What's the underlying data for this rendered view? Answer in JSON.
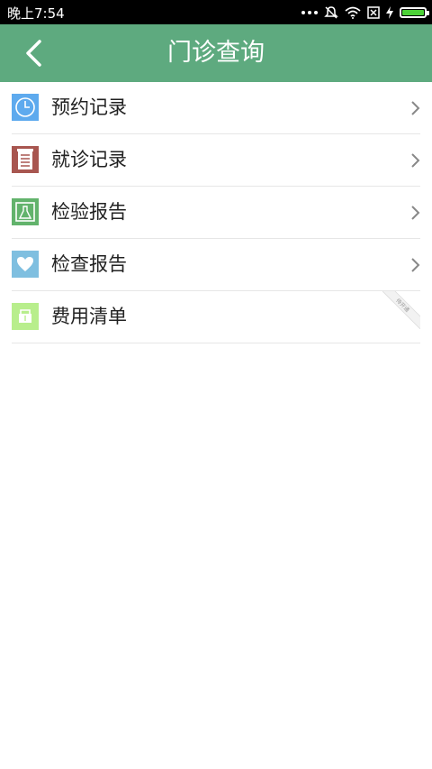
{
  "statusbar": {
    "time": "晚上7:54"
  },
  "appbar": {
    "title": "门诊查询"
  },
  "menu": [
    {
      "label": "预约记录"
    },
    {
      "label": "就诊记录"
    },
    {
      "label": "检验报告"
    },
    {
      "label": "检查报告"
    },
    {
      "label": "费用清单",
      "badge": "待开通"
    }
  ],
  "colors": {
    "appbar": "#5eaa7f",
    "clock_icon": "#5eaaee",
    "record_icon": "#a85650",
    "lab_icon": "#62b36c",
    "heart_icon": "#7fbfe0",
    "bill_icon": "#b8ee8c"
  }
}
